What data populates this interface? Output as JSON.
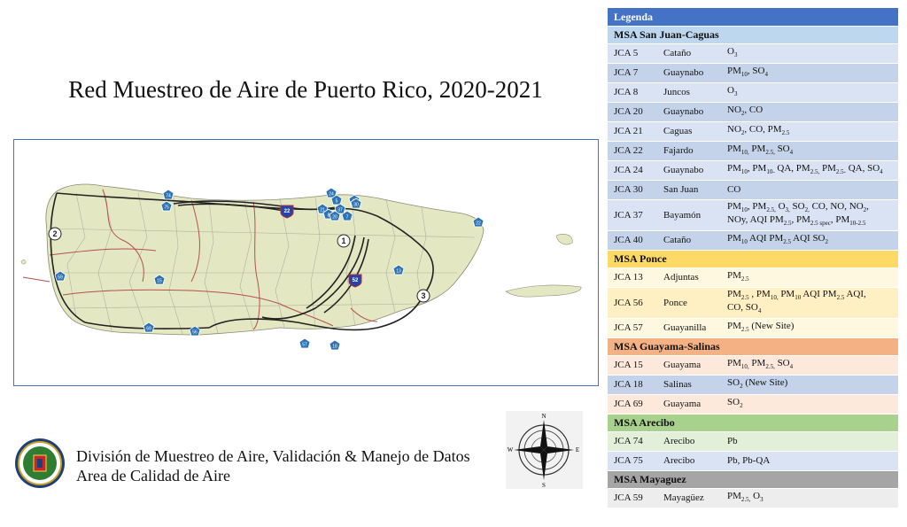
{
  "title": "Red Muestreo de Aire de Puerto Rico, 2020-2021",
  "footer": {
    "line1": "División de Muestreo de Aire, Validación & Manejo de Datos",
    "line2": "Area de Calidad de Aire"
  },
  "compass": {
    "n": "N",
    "s": "S",
    "e": "E",
    "w": "W"
  },
  "map": {
    "circle_labels": [
      "2",
      "1",
      "3"
    ],
    "highway_shields": [
      "22",
      "52"
    ],
    "station_markers": [
      "74",
      "75",
      "24",
      "5",
      "40",
      "21",
      "30",
      "8",
      "37",
      "7",
      "20",
      "22",
      "15",
      "59",
      "56",
      "13",
      "69",
      "18",
      "57"
    ]
  },
  "legend": {
    "heading": "Legenda",
    "groups": [
      {
        "name": "MSA San Juan-Caguas",
        "color": "blue",
        "rows": [
          {
            "id": "JCA 5",
            "city": "Cataño",
            "pollutants": "O<sub>3</sub>"
          },
          {
            "id": "JCA 7",
            "city": "Guaynabo",
            "pollutants": "PM<sub>10</sub>, SO<sub>4</sub>"
          },
          {
            "id": "JCA 8",
            "city": "Juncos",
            "pollutants": "O<sub>3</sub>"
          },
          {
            "id": "JCA 20",
            "city": "Guaynabo",
            "pollutants": "NO<sub>2</sub>, CO"
          },
          {
            "id": "JCA 21",
            "city": "Caguas",
            "pollutants": "NO<sub>2</sub>, CO, PM<sub>2.5</sub>"
          },
          {
            "id": "JCA 22",
            "city": "Fajardo",
            "pollutants": "PM<sub>10,</sub> PM<sub>2.5,</sub> SO<sub>4</sub>"
          },
          {
            "id": "JCA 24",
            "city": "Guaynabo",
            "pollutants": "PM<sub>10</sub>, PM<sub>10-</sub> QA, PM<sub>2.5,</sub> PM<sub>2.5-</sub> QA, SO<sub>4</sub>"
          },
          {
            "id": "JCA 30",
            "city": "San Juan",
            "pollutants": "CO"
          },
          {
            "id": "JCA 37",
            "city": "Bayamón",
            "pollutants": "PM<sub>10</sub>, PM<sub>2.5,</sub> O<sub>3,</sub> SO<sub>2,</sub> CO, NO, NO<sub>2</sub>,<br>NOy, AQI PM<sub>2.5</sub>,  PM<sub>2.5 spec</sub>, PM<sub>10-2.5</sub>",
            "tall": true
          },
          {
            "id": "JCA 40",
            "city": "Cataño",
            "pollutants": "PM<sub>10</sub> AQI PM<sub>2.5</sub> AQI SO<sub>2</sub>"
          }
        ]
      },
      {
        "name": "MSA  Ponce",
        "color": "yellow",
        "rows": [
          {
            "id": "JCA 13",
            "city": "Adjuntas",
            "pollutants": "PM<sub>2.5</sub>"
          },
          {
            "id": "JCA 56",
            "city": "Ponce",
            "pollutants": "PM<sub>2.5</sub> , PM<sub>10,</sub> PM<sub>10</sub> AQI PM<sub>2.5</sub> AQI,<br>CO, SO<sub>4</sub>",
            "tall": true
          },
          {
            "id": "JCA 57",
            "city": "Guayanilla",
            "pollutants": "PM<sub>2.5</sub> (New Site)"
          }
        ]
      },
      {
        "name": "MSA Guayama-Salinas",
        "color": "orange",
        "rows": [
          {
            "id": "JCA 15",
            "city": "Guayama",
            "pollutants": "PM<sub>10,</sub> PM<sub>2.5,</sub> SO<sub>4</sub>"
          },
          {
            "id": "JCA 18",
            "city": "Salinas",
            "pollutants": "SO<sub>2</sub> (New Site)"
          },
          {
            "id": "JCA 69",
            "city": "Guayama",
            "pollutants": "SO<sub>2</sub>"
          }
        ]
      },
      {
        "name": "MSA Arecibo",
        "color": "green",
        "rows": [
          {
            "id": "JCA 74",
            "city": "Arecibo",
            "pollutants": "Pb"
          },
          {
            "id": "JCA 75",
            "city": "Arecibo",
            "pollutants": "Pb, Pb-QA"
          }
        ]
      },
      {
        "name": "MSA Mayaguez",
        "color": "gray",
        "rows": [
          {
            "id": "JCA 59",
            "city": "Mayagüez",
            "pollutants": "PM<sub>2.5,</sub> O<sub>3</sub>"
          }
        ]
      }
    ]
  }
}
